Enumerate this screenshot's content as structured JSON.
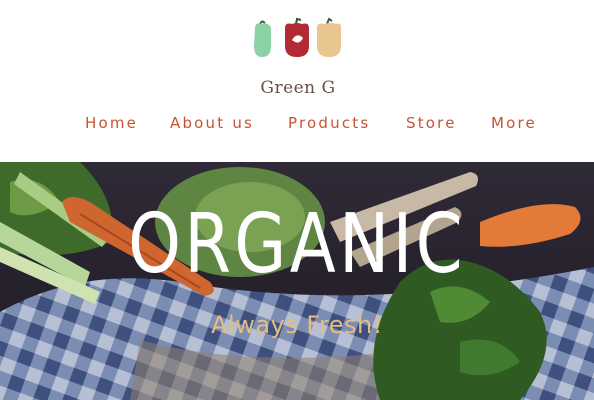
{
  "brand": {
    "name": "Green G",
    "colors": {
      "pepper_green": "#8dd1a7",
      "pepper_red": "#b22a33",
      "pepper_yellow": "#e9c68f",
      "text": "#6a4e42"
    }
  },
  "nav": {
    "items": [
      {
        "label": "Home"
      },
      {
        "label": "About us"
      },
      {
        "label": "Products"
      },
      {
        "label": "Store"
      },
      {
        "label": "More"
      }
    ],
    "color": "#c5542f"
  },
  "hero": {
    "title": "organic",
    "subtitle": "Always Fresh!",
    "title_color": "#ffffff",
    "subtitle_color": "#e3be82",
    "image": "vegetable-basket-photo"
  }
}
